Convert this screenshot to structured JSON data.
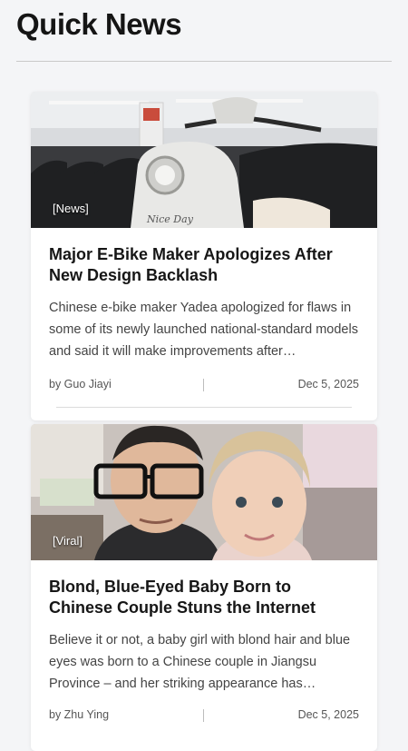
{
  "header": {
    "title": "Quick News"
  },
  "articles": [
    {
      "tag": "[News]",
      "title": "Major E-Bike Maker Apologizes After New Design Backlash",
      "summary": "Chinese e-bike maker Yadea apologized for flaws in some of its newly launched national-standard models and said it will make improvements after…",
      "author": "by Guo Jiayi",
      "date": "Dec 5, 2025"
    },
    {
      "tag": "[Viral]",
      "title": "Blond, Blue-Eyed Baby Born to Chinese Couple Stuns the Internet",
      "summary": "Believe it or not, a baby girl with blond hair and blue eyes was born to a Chinese couple in Jiangsu Province – and her striking appearance has…",
      "author": "by Zhu Ying",
      "date": "Dec 5, 2025"
    }
  ]
}
